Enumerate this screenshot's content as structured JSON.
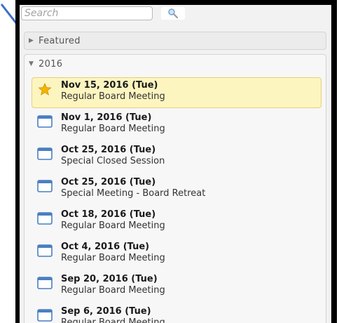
{
  "search": {
    "placeholder": "Search",
    "icon": "magnifier-icon"
  },
  "featured": {
    "label": "Featured",
    "expanded": false
  },
  "year_group": {
    "label": "2016",
    "expanded": true,
    "meetings": [
      {
        "date": "Nov 15, 2016 (Tue)",
        "title": "Regular Board Meeting",
        "icon": "star-icon",
        "selected": true
      },
      {
        "date": "Nov 1, 2016 (Tue)",
        "title": "Regular Board Meeting",
        "icon": "calendar-icon",
        "selected": false
      },
      {
        "date": "Oct 25, 2016 (Tue)",
        "title": "Special Closed Session",
        "icon": "calendar-icon",
        "selected": false
      },
      {
        "date": "Oct 25, 2016 (Tue)",
        "title": "Special Meeting - Board Retreat",
        "icon": "calendar-icon",
        "selected": false
      },
      {
        "date": "Oct 18, 2016 (Tue)",
        "title": "Regular Board Meeting",
        "icon": "calendar-icon",
        "selected": false
      },
      {
        "date": "Oct 4, 2016 (Tue)",
        "title": "Regular Board Meeting",
        "icon": "calendar-icon",
        "selected": false
      },
      {
        "date": "Sep 20, 2016 (Tue)",
        "title": "Regular Board Meeting",
        "icon": "calendar-icon",
        "selected": false
      },
      {
        "date": "Sep 6, 2016 (Tue)",
        "title": "Regular Board Meeting",
        "icon": "calendar-icon",
        "selected": false
      }
    ]
  },
  "colors": {
    "selected_bg": "#fdf5c0",
    "calendar_blue": "#4a7fc1",
    "star_gold": "#f4b400",
    "annotation_arrow": "#3c6fc4"
  }
}
